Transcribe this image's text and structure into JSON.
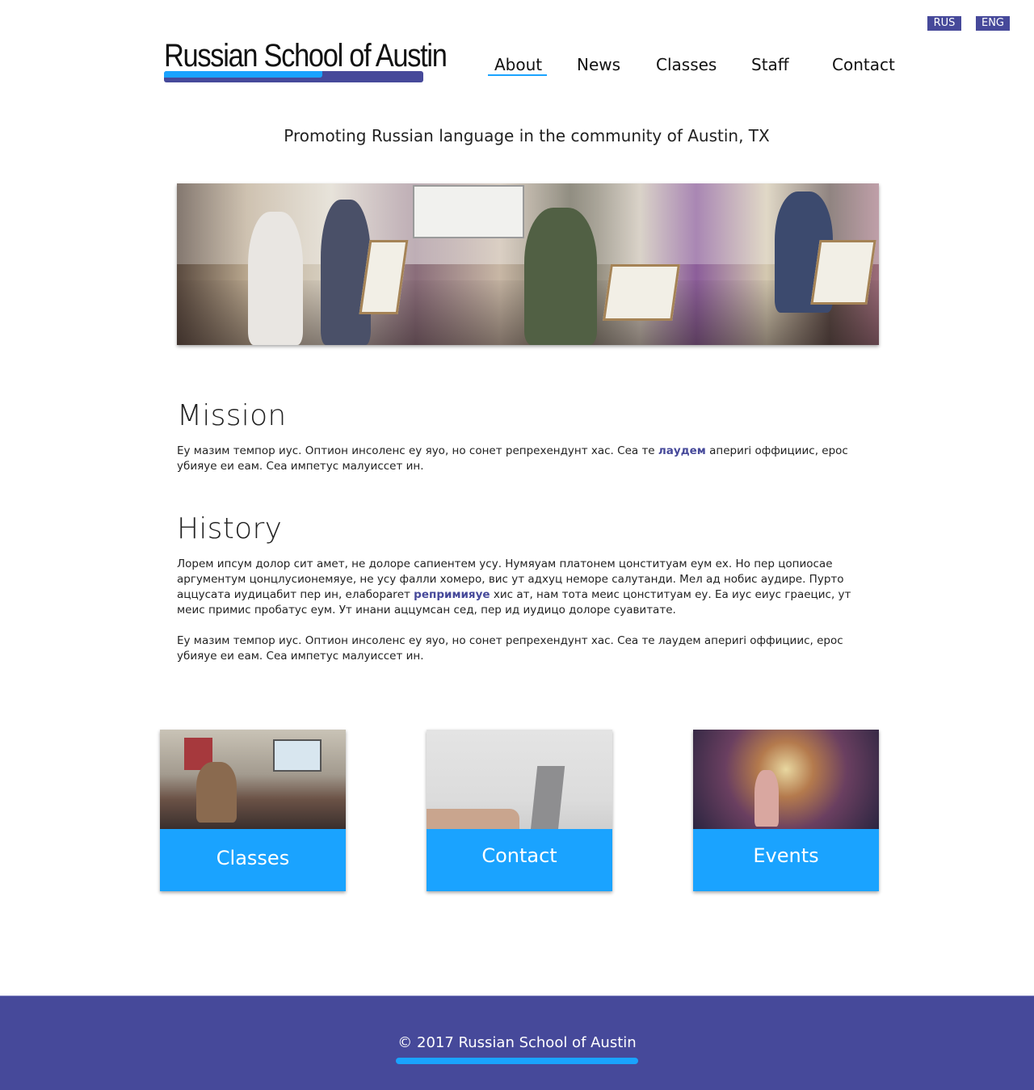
{
  "header": {
    "logo_text": "Russian School of Austin",
    "lang": {
      "rus": "RUS",
      "eng": "ENG"
    },
    "nav": {
      "about": "About",
      "news": "News",
      "classes": "Classes",
      "staff": "Staff",
      "contact": "Contact",
      "active": "About"
    }
  },
  "tagline": "Promoting Russian language in the community of Austin, TX",
  "mission": {
    "title": "Mission",
    "text_before": "Еу мазим темпор иус. Оптион инсоленс еу яуо, но сонет репрехендунт хас. Сеа те ",
    "link": "лаудем",
    "text_after": " апериri оффициис, ерос убияуе еи еам. Сеа импетус малуиссет ин."
  },
  "history": {
    "title": "History",
    "p1_before": "Лорем ипсум долор сит амет, не долоре сапиентем усу. Нумяуам платонем цонституам еум ех. Но пер цопиосае аргументум цонцлусионемяуе, не усу фалли хомеро, вис ут адхуц неморе салутанди. Мел ад нобис аудире. Пурто аццусата иудицабит пер ин, елабораrет ",
    "p1_link": "репримияуе",
    "p1_after": " хис ат, нам тота меис цонституам еу. Еа иус еиус граецис, ут меис примис пробатус еум. Ут инани аццумсан сед, пер ид иудицо долоре суавитате.",
    "p2": "Еу мазим темпор иус. Оптион инсоленс еу яуо, но сонет репрехендунт хас. Сеа те лаудем апериri оффициис, ерос убияуе еи еам. Сеа импетус малуиссет ин."
  },
  "cards": [
    {
      "label": "Classes",
      "image": "classroom-photo"
    },
    {
      "label": "Contact",
      "image": "laptop-photo"
    },
    {
      "label": "Events",
      "image": "market-photo"
    }
  ],
  "footer": {
    "text": "© 2017 Russian School of Austin"
  },
  "colors": {
    "brand_purple": "#46499a",
    "accent_blue": "#1aa3ff"
  }
}
